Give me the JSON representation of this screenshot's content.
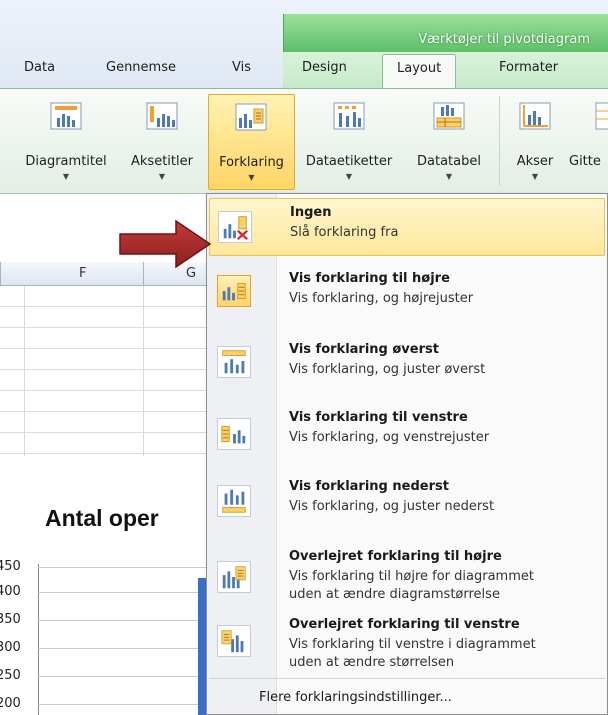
{
  "ribbon": {
    "context_title": "Værktøjer til pivotdiagram",
    "tabs": [
      {
        "label": "Data"
      },
      {
        "label": "Gennemse"
      },
      {
        "label": "Vis"
      },
      {
        "label": "Design"
      },
      {
        "label": "Layout"
      },
      {
        "label": "Formater"
      }
    ],
    "buttons": [
      {
        "label": "Diagramtitel"
      },
      {
        "label": "Aksetitler"
      },
      {
        "label": "Forklaring"
      },
      {
        "label": "Dataetiketter"
      },
      {
        "label": "Datatabel"
      },
      {
        "label": "Akser"
      },
      {
        "label": "Gitte"
      }
    ]
  },
  "sheet": {
    "columns": [
      "F",
      "G"
    ],
    "chart_title": "Antal oper",
    "y_ticks": [
      "450",
      "400",
      "350",
      "300",
      "250",
      "200"
    ]
  },
  "menu": {
    "items": [
      {
        "title": "Ingen",
        "desc": "Slå forklaring fra"
      },
      {
        "title": "Vis forklaring til højre",
        "desc": "Vis forklaring, og højrejuster"
      },
      {
        "title": "Vis forklaring øverst",
        "desc": "Vis forklaring, og juster øverst"
      },
      {
        "title": "Vis forklaring til venstre",
        "desc": "Vis forklaring, og venstrejuster"
      },
      {
        "title": "Vis forklaring nederst",
        "desc": "Vis forklaring, og juster nederst"
      },
      {
        "title": "Overlejret forklaring til højre",
        "desc": "Vis forklaring til højre for diagrammet\nuden at ændre diagramstørrelse"
      },
      {
        "title": "Overlejret forklaring til venstre",
        "desc": "Vis forklaring til venstre i diagrammet\nuden at ændre størrelsen"
      }
    ],
    "footer": "Flere forklaringsindstillinger..."
  },
  "colors": {
    "context_green": "#5fbf6a",
    "highlight_yellow": "#ffe79a",
    "arrow_red": "#b22a2a",
    "bar_blue": "#3a6fc4"
  }
}
